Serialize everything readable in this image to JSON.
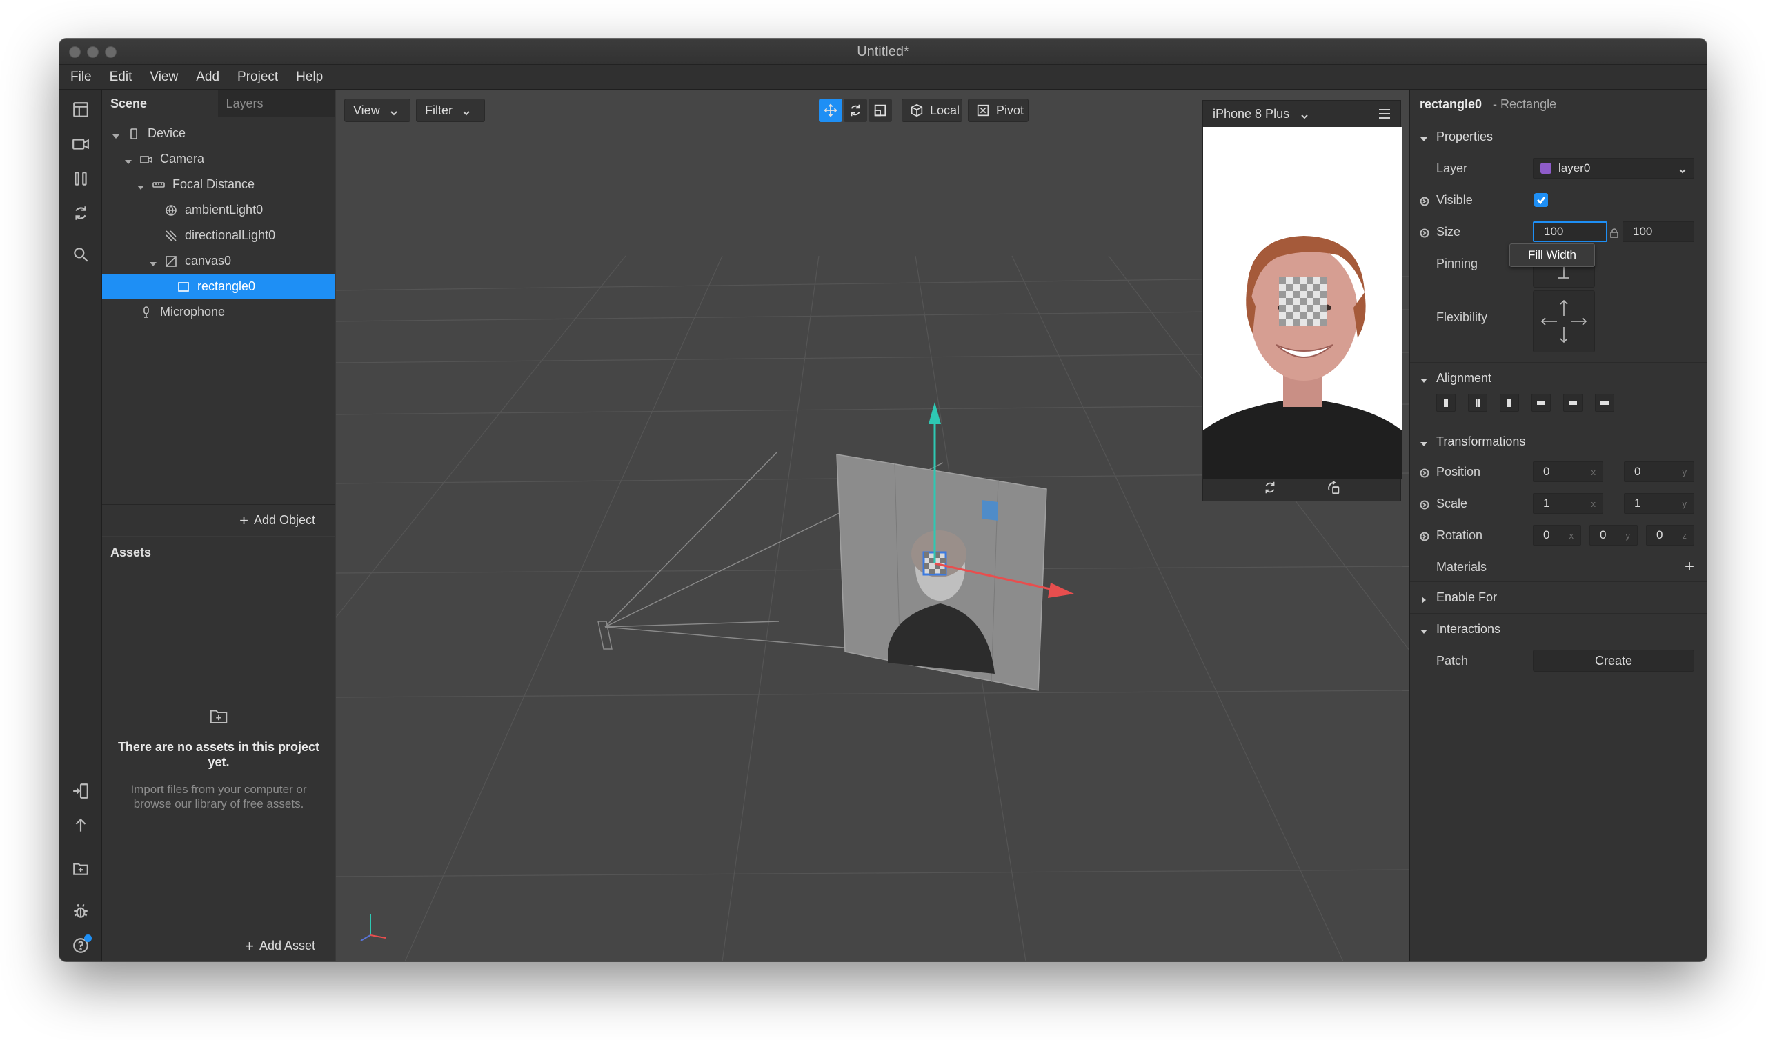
{
  "window": {
    "title": "Untitled*"
  },
  "menu": [
    "File",
    "Edit",
    "View",
    "Add",
    "Project",
    "Help"
  ],
  "scene_panel": {
    "tabs": [
      "Scene",
      "Layers"
    ],
    "tree": [
      {
        "label": "Device",
        "indent": 0,
        "caret": true,
        "icon": "device-icon"
      },
      {
        "label": "Camera",
        "indent": 1,
        "caret": true,
        "icon": "camera-icon"
      },
      {
        "label": "Focal Distance",
        "indent": 2,
        "caret": true,
        "icon": "focal-distance-icon"
      },
      {
        "label": "ambientLight0",
        "indent": 3,
        "caret": false,
        "icon": "ambient-light-icon"
      },
      {
        "label": "directionalLight0",
        "indent": 3,
        "caret": false,
        "icon": "directional-light-icon"
      },
      {
        "label": "canvas0",
        "indent": 3,
        "caret": true,
        "icon": "canvas-icon"
      },
      {
        "label": "rectangle0",
        "indent": 4,
        "caret": false,
        "icon": "rectangle-icon",
        "selected": true
      },
      {
        "label": "Microphone",
        "indent": 1,
        "caret": false,
        "icon": "microphone-icon"
      }
    ],
    "add_object": "Add Object"
  },
  "assets_panel": {
    "title": "Assets",
    "empty_title": "There are no assets in this project yet.",
    "empty_hint": "Import files from your computer or browse our library of free assets.",
    "add_asset": "Add Asset"
  },
  "viewport": {
    "view_label": "View",
    "filter_label": "Filter",
    "local_label": "Local",
    "pivot_label": "Pivot",
    "device_name": "iPhone 8 Plus"
  },
  "inspector": {
    "object_name": "rectangle0",
    "object_type": "- Rectangle",
    "sections": {
      "properties": "Properties",
      "alignment": "Alignment",
      "transformations": "Transformations",
      "materials": "Materials",
      "enable_for": "Enable For",
      "interactions": "Interactions"
    },
    "layer": {
      "label": "Layer",
      "value": "layer0",
      "color": "#8e5cc9"
    },
    "visible": {
      "label": "Visible",
      "checked": true
    },
    "size": {
      "label": "Size",
      "width": "100",
      "height": "100"
    },
    "pinning": {
      "label": "Pinning",
      "tooltip": "Fill Width"
    },
    "flexibility": {
      "label": "Flexibility"
    },
    "position": {
      "label": "Position",
      "x": "0",
      "y": "0"
    },
    "scale": {
      "label": "Scale",
      "x": "1",
      "y": "1"
    },
    "rotation": {
      "label": "Rotation",
      "x": "0",
      "y": "0",
      "z": "0"
    },
    "patch": {
      "label": "Patch",
      "button": "Create"
    }
  },
  "colors": {
    "accent": "#1e8ff5",
    "gizmo_y": "#2ec8b3",
    "gizmo_x": "#e84e4e",
    "layer_swatch": "#8e5cc9"
  }
}
